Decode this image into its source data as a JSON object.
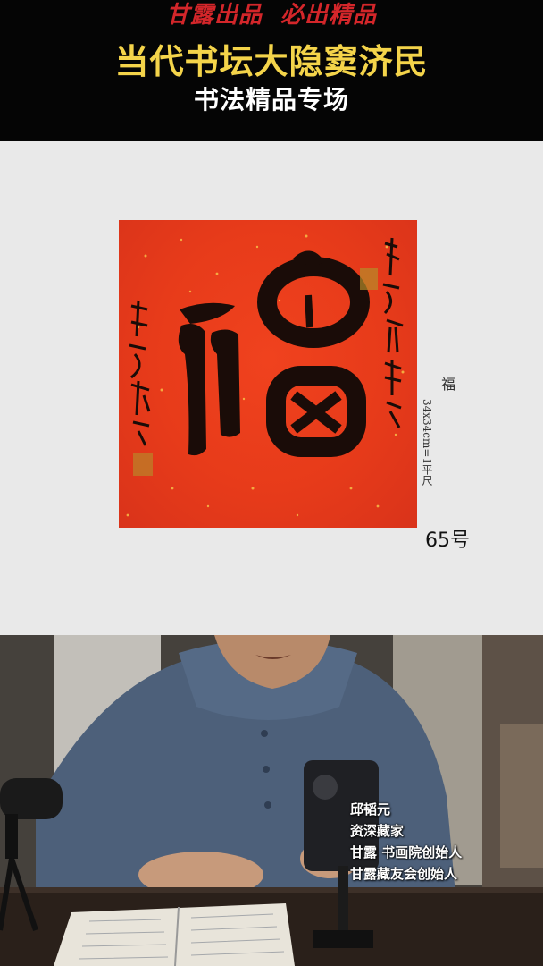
{
  "header": {
    "tagline": "甘露出品  必出精品",
    "title": "当代书坛大隐窦济民",
    "subtitle": "书法精品专场",
    "colors": {
      "background": "#050505",
      "tagline": "#d3262a",
      "title": "#f4d44a",
      "subtitle": "#ffffff"
    }
  },
  "product": {
    "artwork_icon": "fu-calligraphy-artwork",
    "title": "福",
    "size": "34x34cm=1平尺",
    "number": "65号",
    "colors": {
      "background": "#e9e9e9",
      "paper": "#e73b1a",
      "ink": "#1a0c08"
    }
  },
  "video": {
    "caption": {
      "line1": "邱韬元",
      "line2": "资深藏家",
      "line3": "甘露 书画院创始人",
      "line4": "甘露藏友会创始人"
    }
  }
}
